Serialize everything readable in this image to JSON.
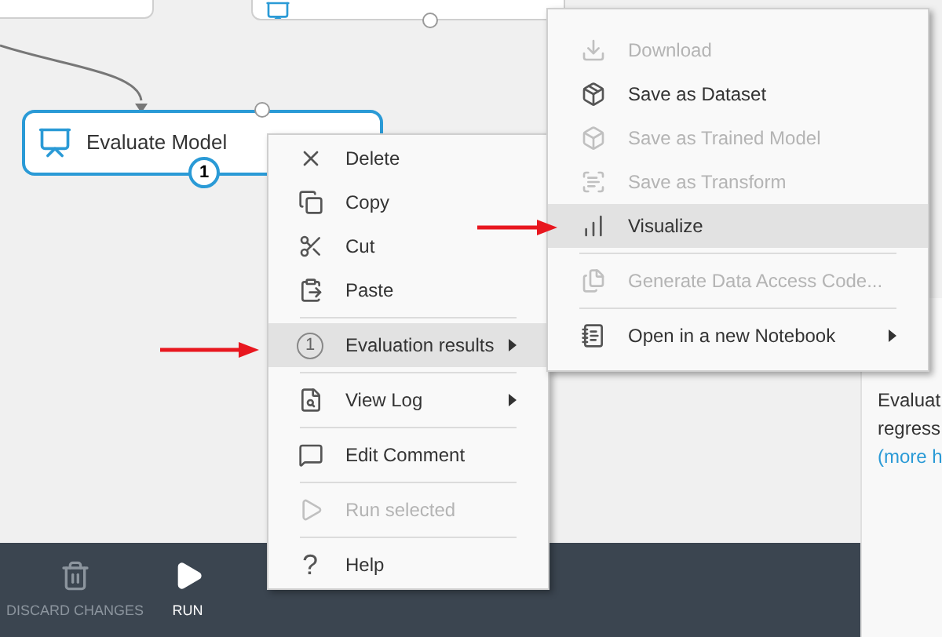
{
  "canvas": {
    "nodes": [
      {
        "kind": "cut"
      },
      {
        "kind": "cut-icon"
      },
      {
        "kind": "module",
        "title": "Evaluate Model",
        "badge": "1",
        "selected": true
      }
    ]
  },
  "context_menu": [
    {
      "kind": "item",
      "label": "Delete",
      "disabled": false,
      "selected": false,
      "submenu": false
    },
    {
      "kind": "item",
      "label": "Copy",
      "disabled": false,
      "selected": false,
      "submenu": false
    },
    {
      "kind": "item",
      "label": "Cut",
      "disabled": false,
      "selected": false,
      "submenu": false
    },
    {
      "kind": "item",
      "label": "Paste",
      "disabled": false,
      "selected": false,
      "submenu": false
    },
    {
      "kind": "separator"
    },
    {
      "kind": "item",
      "label": "Evaluation results",
      "badge": "1",
      "disabled": false,
      "selected": true,
      "submenu": true
    },
    {
      "kind": "separator"
    },
    {
      "kind": "item",
      "label": "View Log",
      "disabled": false,
      "selected": false,
      "submenu": true
    },
    {
      "kind": "separator"
    },
    {
      "kind": "item",
      "label": "Edit Comment",
      "disabled": false,
      "selected": false,
      "submenu": false
    },
    {
      "kind": "separator"
    },
    {
      "kind": "item",
      "label": "Run selected",
      "disabled": true,
      "selected": false,
      "submenu": false
    },
    {
      "kind": "separator"
    },
    {
      "kind": "item",
      "label": "Help",
      "glyph": "?",
      "disabled": false,
      "selected": false,
      "submenu": false
    }
  ],
  "submenu": [
    {
      "kind": "item",
      "label": "Download",
      "disabled": true,
      "selected": false,
      "submenu": false
    },
    {
      "kind": "item",
      "label": "Save as Dataset",
      "disabled": false,
      "selected": false,
      "submenu": false
    },
    {
      "kind": "item",
      "label": "Save as Trained Model",
      "disabled": true,
      "selected": false,
      "submenu": false
    },
    {
      "kind": "item",
      "label": "Save as Transform",
      "disabled": true,
      "selected": false,
      "submenu": false
    },
    {
      "kind": "item",
      "label": "Visualize",
      "disabled": false,
      "selected": true,
      "submenu": false
    },
    {
      "kind": "separator"
    },
    {
      "kind": "item",
      "label": "Generate Data Access Code...",
      "disabled": true,
      "selected": false,
      "submenu": false
    },
    {
      "kind": "separator"
    },
    {
      "kind": "item",
      "label": "Open in a new Notebook",
      "disabled": false,
      "selected": false,
      "submenu": true
    }
  ],
  "properties_panel": {
    "lines": [
      "Evaluat",
      "regress"
    ],
    "link": "(more h"
  },
  "toolbar": [
    {
      "label": "DISCARD CHANGES",
      "disabled": true
    },
    {
      "label": "RUN",
      "disabled": false
    }
  ]
}
